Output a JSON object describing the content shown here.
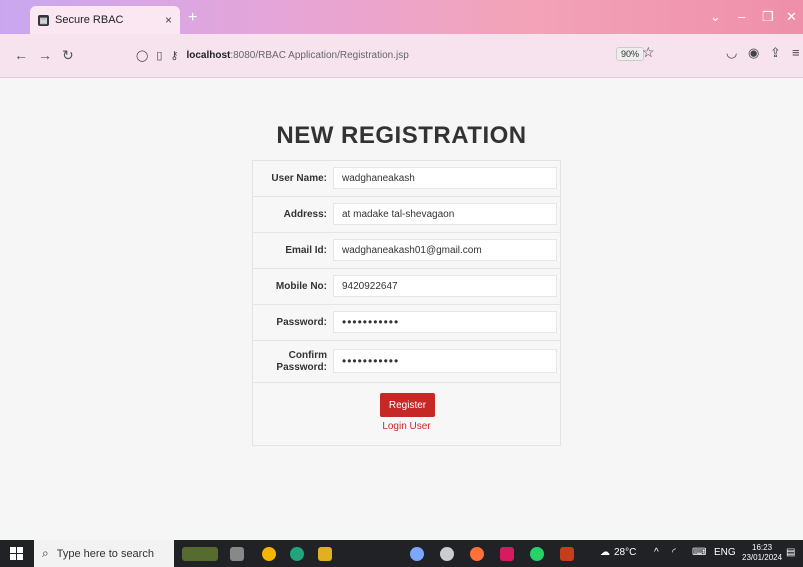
{
  "browser": {
    "tab_title": "Secure RBAC",
    "tab_close": "×",
    "new_tab": "+",
    "url_host": "localhost",
    "url_path": ":8080/RBAC Application/Registration.jsp",
    "zoom": "90%"
  },
  "page": {
    "title": "NEW REGISTRATION",
    "fields": {
      "username": {
        "label": "User Name:",
        "value": "wadghaneakash"
      },
      "address": {
        "label": "Address:",
        "value": "at madake tal-shevagaon"
      },
      "email": {
        "label": "Email Id:",
        "value": "wadghaneakash01@gmail.com"
      },
      "mobile": {
        "label": "Mobile No:",
        "value": "9420922647"
      },
      "password": {
        "label": "Password:",
        "value": "•••••••••••"
      },
      "confirm": {
        "label_line1": "Confirm",
        "label_line2": "Password:",
        "value": "•••••••••••"
      }
    },
    "register_label": "Register",
    "login_link": "Login User"
  },
  "taskbar": {
    "search_placeholder": "Type here to search",
    "weather": "28°C",
    "language": "ENG",
    "time": "16:23",
    "date": "23/01/2024"
  },
  "colors": {
    "accent": "#c62828",
    "titlebar": "#e6a5d8"
  }
}
